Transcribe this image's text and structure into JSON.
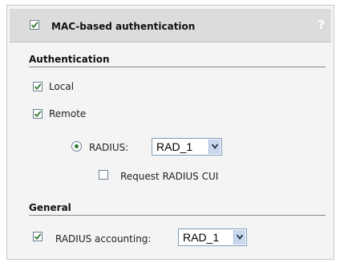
{
  "header": {
    "title": "MAC-based authentication",
    "help": "?",
    "enabled": true
  },
  "authentication": {
    "title": "Authentication",
    "local": {
      "label": "Local",
      "checked": true
    },
    "remote": {
      "label": "Remote",
      "checked": true
    },
    "radius": {
      "label": "RADIUS:",
      "selected": true,
      "value": "RAD_1"
    },
    "request_cui": {
      "label": "Request RADIUS CUI",
      "checked": false
    }
  },
  "general": {
    "title": "General",
    "accounting": {
      "label": "RADIUS accounting:",
      "checked": true,
      "value": "RAD_1"
    }
  },
  "colors": {
    "check_green": "#2f7a2f",
    "header_bg": "#dcdcdc",
    "panel_bg": "#f4f4f4"
  }
}
